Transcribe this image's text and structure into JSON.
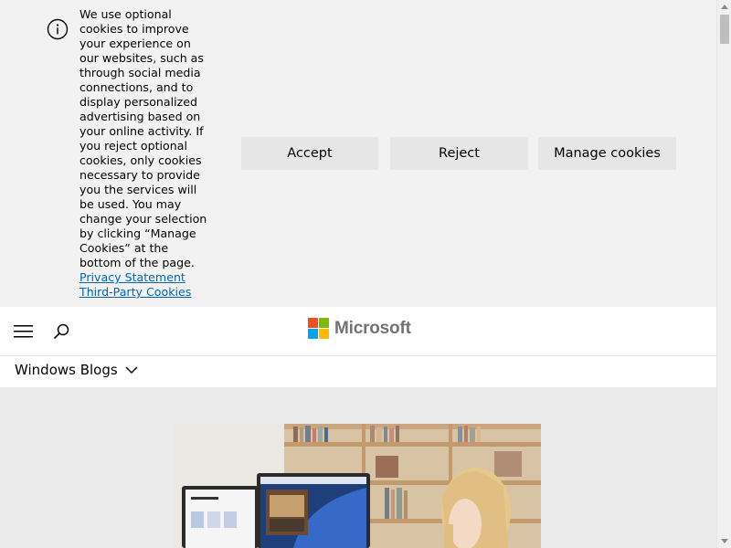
{
  "cookie_banner": {
    "message": "We use optional cookies to improve your experience on our websites, such as through social media connections, and to display personalized advertising based on your online activity. If you reject optional cookies, only cookies necessary to provide you the services will be used. You may change your selection by clicking “Manage Cookies” at the bottom of the page.",
    "privacy_link": "Privacy Statement",
    "third_party_link": "Third-Party Cookies",
    "accept_label": "Accept",
    "reject_label": "Reject",
    "manage_label": "Manage cookies"
  },
  "header": {
    "logo_text": "Microsoft",
    "menu_icon": "hamburger-icon",
    "search_icon": "search-icon",
    "logo_colors": [
      "#f25022",
      "#7fba00",
      "#00a4ef",
      "#ffb900"
    ]
  },
  "subnav": {
    "label": "Windows Blogs",
    "icon": "chevron-down-icon"
  },
  "colors": {
    "link": "#0067b8",
    "button_bg": "#e6e6e6",
    "banner_bg": "#f2f2f2"
  }
}
